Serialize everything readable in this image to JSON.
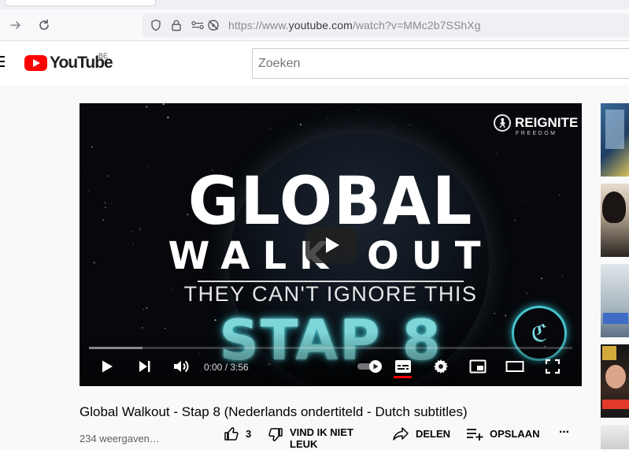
{
  "browser": {
    "url_prefix": "https://www.",
    "url_domain": "youtube.com",
    "url_path": "/watch?v=MMc2b7SShXg"
  },
  "header": {
    "logo_text": "YouTube",
    "country_code": "BE",
    "search_placeholder": "Zoeken"
  },
  "player": {
    "brand_name": "REIGNITE",
    "brand_sub": "FREEDOM",
    "title_line1": "GLOBAL",
    "title_line2": "WALK OUT",
    "title_line3": "THEY CAN'T IGNORE THIS",
    "title_line4": "STAP 8",
    "time_current": "0:00",
    "time_separator": " / ",
    "time_total": "3:56",
    "buffered_fraction": 0.11
  },
  "video": {
    "title": "Global Walkout - Stap 8 (Nederlands ondertiteld - Dutch subtitles)",
    "views": "234 weergaven…",
    "like_count": "3",
    "dislike_label": "VIND IK NIET LEUK",
    "share_label": "DELEN",
    "save_label": "OPSLAAN",
    "more_label": "···"
  },
  "colors": {
    "brand_red": "#ff0000",
    "stap_glow": "#2fb4c0"
  }
}
